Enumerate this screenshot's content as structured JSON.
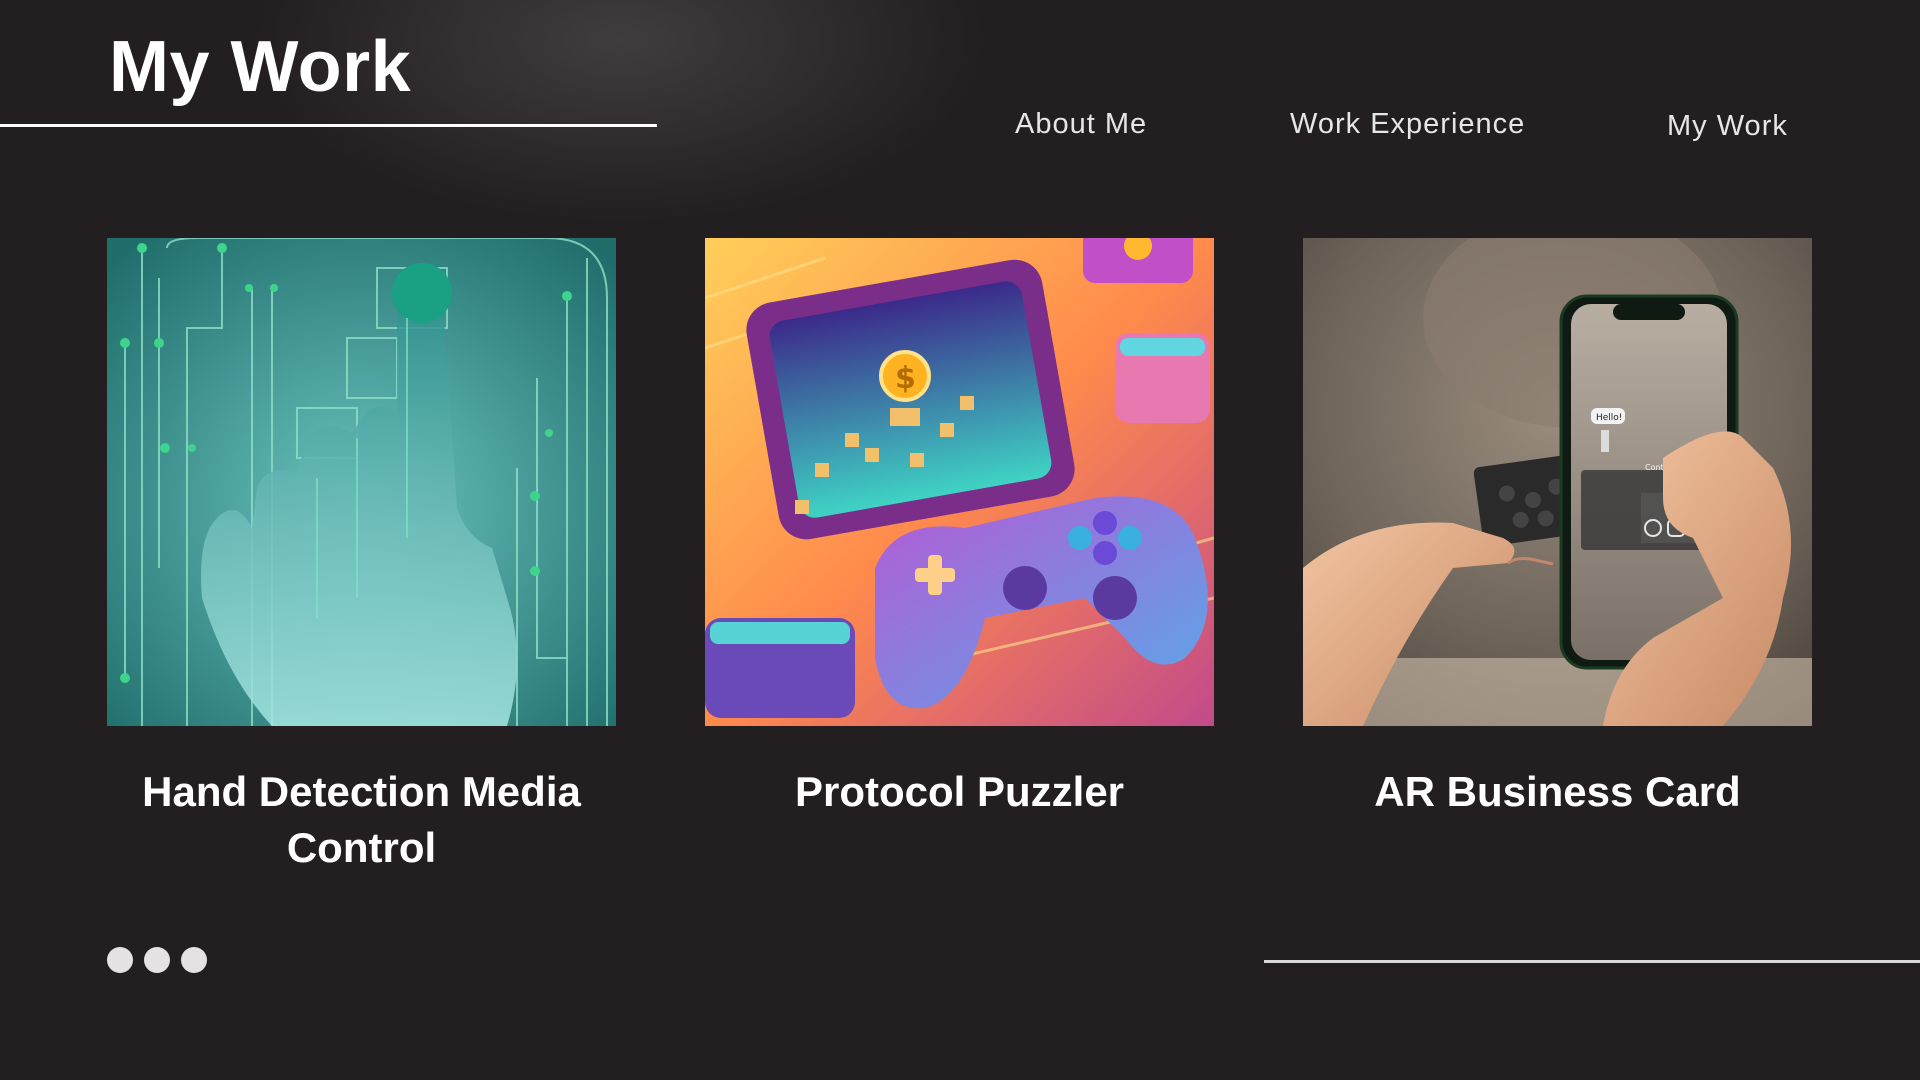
{
  "header": {
    "title": "My Work"
  },
  "nav": {
    "items": [
      {
        "label": "About Me"
      },
      {
        "label": "Work Experience"
      },
      {
        "label": "My Work"
      }
    ]
  },
  "projects": [
    {
      "title": "Hand Detection Media Control",
      "image": "hand-circuit-image"
    },
    {
      "title": "Protocol Puzzler",
      "image": "game-controller-image"
    },
    {
      "title": "AR Business Card",
      "image": "phone-ar-card-image"
    }
  ],
  "thumbnail_text": {
    "speech_bubble": "Hello!",
    "contact_label": "Contact"
  },
  "pagination": {
    "dots": 3
  },
  "colors": {
    "background": "#231f20",
    "text": "#ffffff",
    "nav_text": "#e6e6e6",
    "dot": "#e4e2e2"
  }
}
